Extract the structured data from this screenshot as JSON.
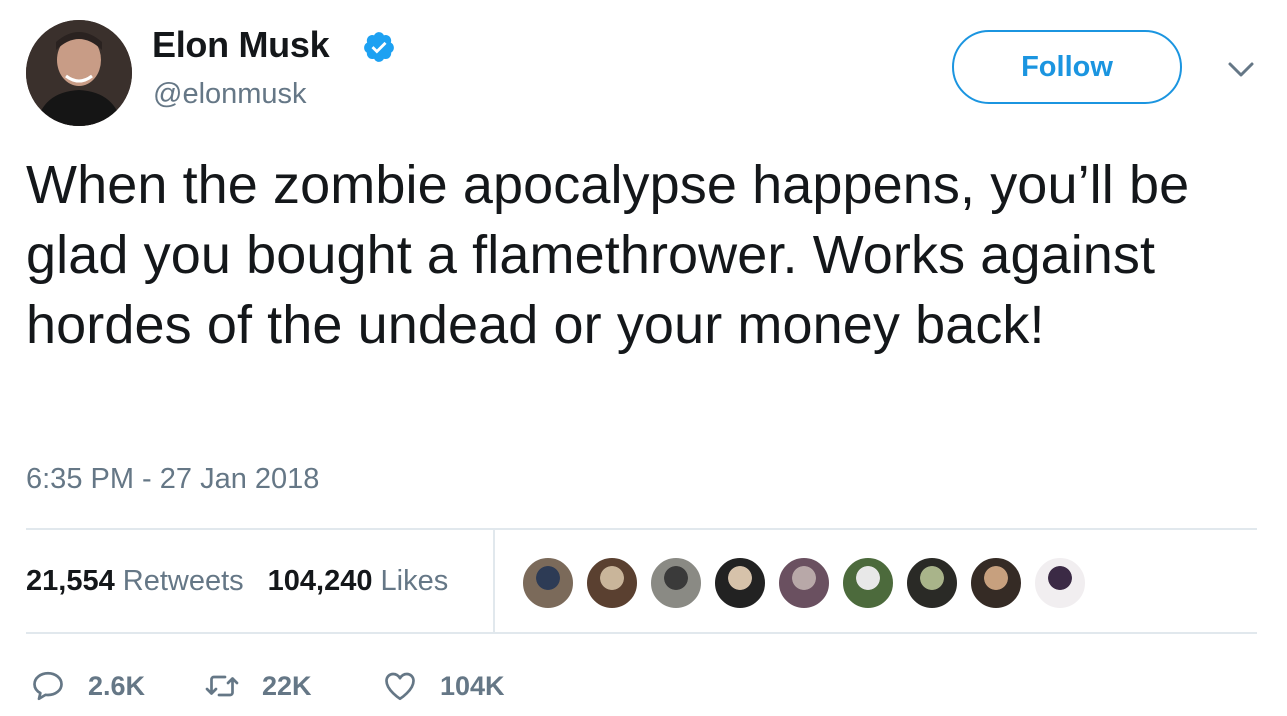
{
  "user": {
    "name": "Elon Musk",
    "handle": "@elonmusk",
    "verified": true
  },
  "follow_label": "Follow",
  "tweet": {
    "text": "When the zombie apocalypse happens, you’ll be glad you bought a flamethrower. Works against hordes of the undead or your money back!",
    "timestamp": "6:35 PM - 27 Jan 2018"
  },
  "stats": {
    "retweets_count": "21,554",
    "retweets_label": "Retweets",
    "likes_count": "104,240",
    "likes_label": "Likes"
  },
  "liker_avatars": [
    {
      "color_a": "#7b6a5a",
      "color_b": "#2d3b55"
    },
    {
      "color_a": "#5a4030",
      "color_b": "#c9b59a"
    },
    {
      "color_a": "#8a8a84",
      "color_b": "#3a3a3a"
    },
    {
      "color_a": "#222222",
      "color_b": "#d6c2aa"
    },
    {
      "color_a": "#6a5060",
      "color_b": "#b8a8a8"
    },
    {
      "color_a": "#4c6a3c",
      "color_b": "#e8e8e8"
    },
    {
      "color_a": "#2a2a26",
      "color_b": "#a9b48a"
    },
    {
      "color_a": "#352b25",
      "color_b": "#c7a07e"
    },
    {
      "color_a": "#f1eef0",
      "color_b": "#3b2a45"
    }
  ],
  "actions": {
    "replies": "2.6K",
    "retweets": "22K",
    "likes": "104K"
  },
  "colors": {
    "accent": "#1b95e0",
    "muted": "#657786",
    "divider": "#e1e8ed"
  }
}
